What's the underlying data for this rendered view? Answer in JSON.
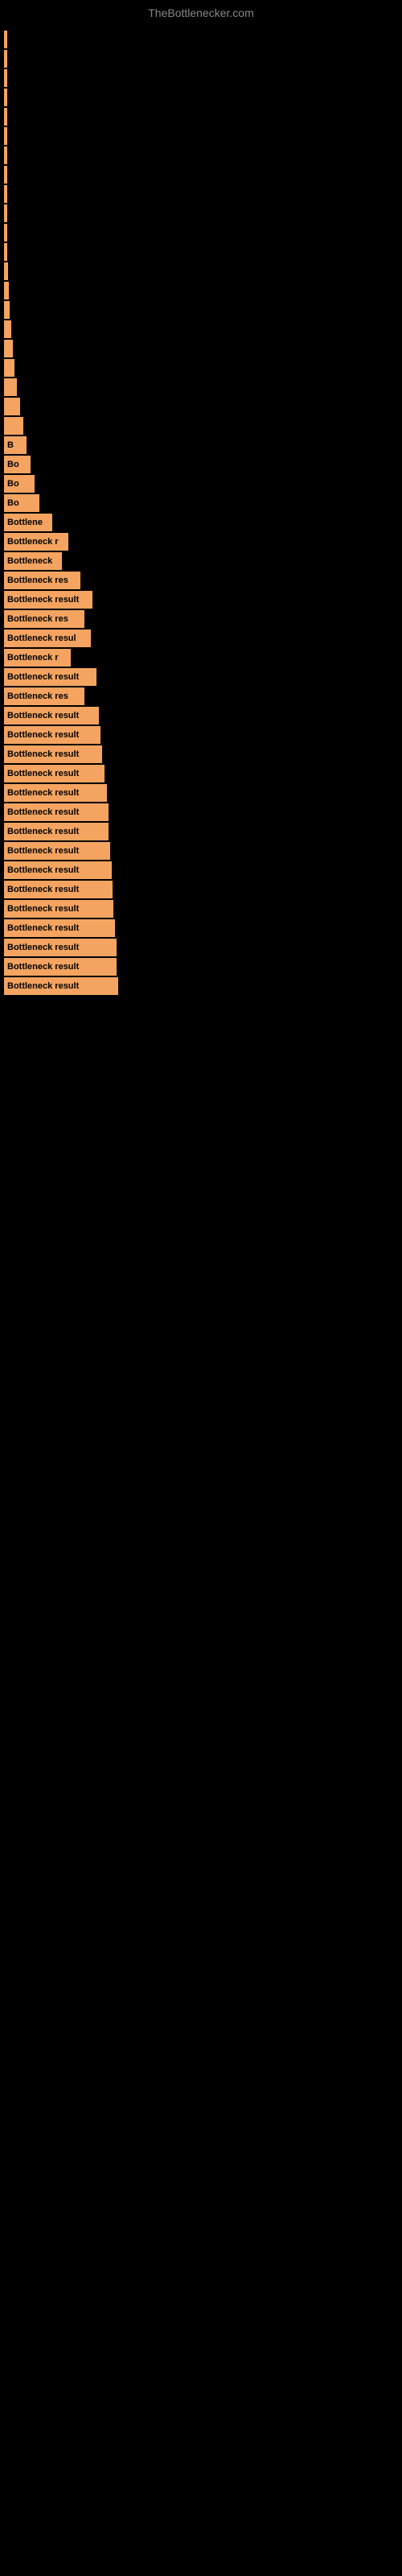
{
  "site": {
    "title": "TheBottlenecker.com"
  },
  "bars": [
    {
      "label": "",
      "width": 2
    },
    {
      "label": "",
      "width": 2
    },
    {
      "label": "",
      "width": 2
    },
    {
      "label": "",
      "width": 2
    },
    {
      "label": "",
      "width": 2
    },
    {
      "label": "",
      "width": 2
    },
    {
      "label": "",
      "width": 2
    },
    {
      "label": "",
      "width": 2
    },
    {
      "label": "",
      "width": 2
    },
    {
      "label": "",
      "width": 2
    },
    {
      "label": "",
      "width": 3
    },
    {
      "label": "",
      "width": 4
    },
    {
      "label": "",
      "width": 5
    },
    {
      "label": "",
      "width": 6
    },
    {
      "label": "",
      "width": 7
    },
    {
      "label": "",
      "width": 9
    },
    {
      "label": "",
      "width": 11
    },
    {
      "label": "",
      "width": 13
    },
    {
      "label": "",
      "width": 16
    },
    {
      "label": "",
      "width": 20
    },
    {
      "label": "",
      "width": 24
    },
    {
      "label": "B",
      "width": 28
    },
    {
      "label": "Bo",
      "width": 33
    },
    {
      "label": "Bo",
      "width": 38
    },
    {
      "label": "Bo",
      "width": 44
    },
    {
      "label": "Bottlene",
      "width": 60
    },
    {
      "label": "Bottleneck r",
      "width": 80
    },
    {
      "label": "Bottleneck",
      "width": 72
    },
    {
      "label": "Bottleneck res",
      "width": 95
    },
    {
      "label": "Bottleneck result",
      "width": 110
    },
    {
      "label": "Bottleneck res",
      "width": 100
    },
    {
      "label": "Bottleneck resul",
      "width": 108
    },
    {
      "label": "Bottleneck r",
      "width": 83
    },
    {
      "label": "Bottleneck result",
      "width": 115
    },
    {
      "label": "Bottleneck res",
      "width": 100
    },
    {
      "label": "Bottleneck result",
      "width": 118
    },
    {
      "label": "Bottleneck result",
      "width": 120
    },
    {
      "label": "Bottleneck result",
      "width": 122
    },
    {
      "label": "Bottleneck result",
      "width": 125
    },
    {
      "label": "Bottleneck result",
      "width": 128
    },
    {
      "label": "Bottleneck result",
      "width": 130
    },
    {
      "label": "Bottleneck result",
      "width": 130
    },
    {
      "label": "Bottleneck result",
      "width": 132
    },
    {
      "label": "Bottleneck result",
      "width": 134
    },
    {
      "label": "Bottleneck result",
      "width": 135
    },
    {
      "label": "Bottleneck result",
      "width": 136
    },
    {
      "label": "Bottleneck result",
      "width": 138
    },
    {
      "label": "Bottleneck result",
      "width": 140
    },
    {
      "label": "Bottleneck result",
      "width": 140
    },
    {
      "label": "Bottleneck result",
      "width": 142
    }
  ]
}
